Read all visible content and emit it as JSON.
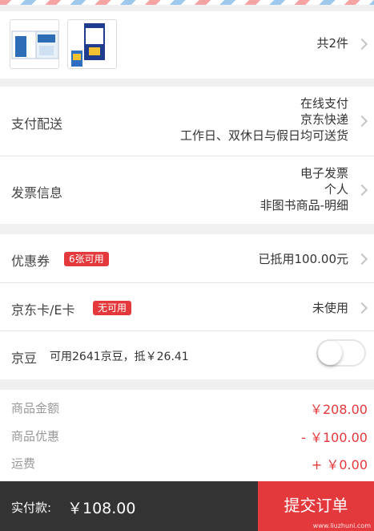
{
  "products": {
    "count_text": "共2件",
    "items": [
      {
        "icon": "milk-box-product-image"
      },
      {
        "icon": "milk-carton-product-image"
      }
    ]
  },
  "delivery": {
    "label": "支付配送",
    "lines": [
      "在线支付",
      "京东快递",
      "工作日、双休日与假日均可送货"
    ]
  },
  "invoice": {
    "label": "发票信息",
    "lines": [
      "电子发票",
      "个人",
      "非图书商品-明细"
    ]
  },
  "coupon": {
    "label": "优惠券",
    "badge": "6张可用",
    "value": "已抵用100.00元"
  },
  "jdcard": {
    "label": "京东卡/E卡",
    "badge": "无可用",
    "value": "未使用"
  },
  "jingdou": {
    "label": "京豆",
    "desc": "可用2641京豆，抵￥26.41",
    "toggle_on": false
  },
  "summary": {
    "goods_label": "商品金额",
    "goods_value": "￥208.00",
    "discount_label": "商品优惠",
    "discount_value": "- ￥100.00",
    "shipping_label": "运费",
    "shipping_value": "+ ￥0.00"
  },
  "footer": {
    "pay_label": "实付款:",
    "pay_value": "￥108.00",
    "submit_label": "提交订单",
    "watermark": "www.liuzhuni.com"
  },
  "colors": {
    "accent": "#e4393c",
    "footer_bg": "#333333"
  }
}
